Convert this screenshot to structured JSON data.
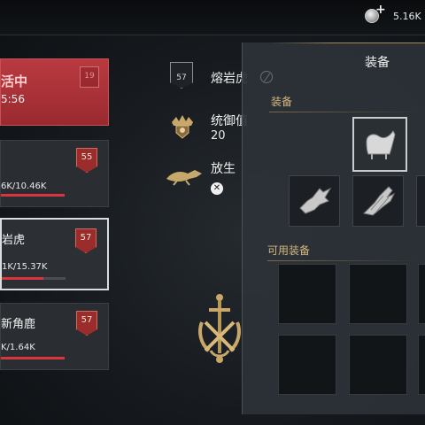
{
  "currency": {
    "value": "5.16K",
    "icon": "silver-coin-icon",
    "plus": "+"
  },
  "list": [
    {
      "title": "活中",
      "subtitle": "",
      "time": "5:56",
      "level": "19",
      "tag": "",
      "state": "active"
    },
    {
      "title": "",
      "value": "6K/10.46K",
      "level": "55",
      "progress": 0.57
    },
    {
      "title": "岩虎",
      "value": "1K/15.37K",
      "level": "57",
      "progress": 0.6,
      "selected": true
    },
    {
      "title": "新角鹿",
      "value": "K/1.64K",
      "level": "57",
      "progress": 0.98
    }
  ],
  "middle": {
    "name": "熔岩虎",
    "level": "57",
    "command_label": "统御值",
    "command_value": "20",
    "release_label": "放生"
  },
  "panel": {
    "title": "装备",
    "equipped_label": "装备",
    "available_label": "可用装备"
  }
}
